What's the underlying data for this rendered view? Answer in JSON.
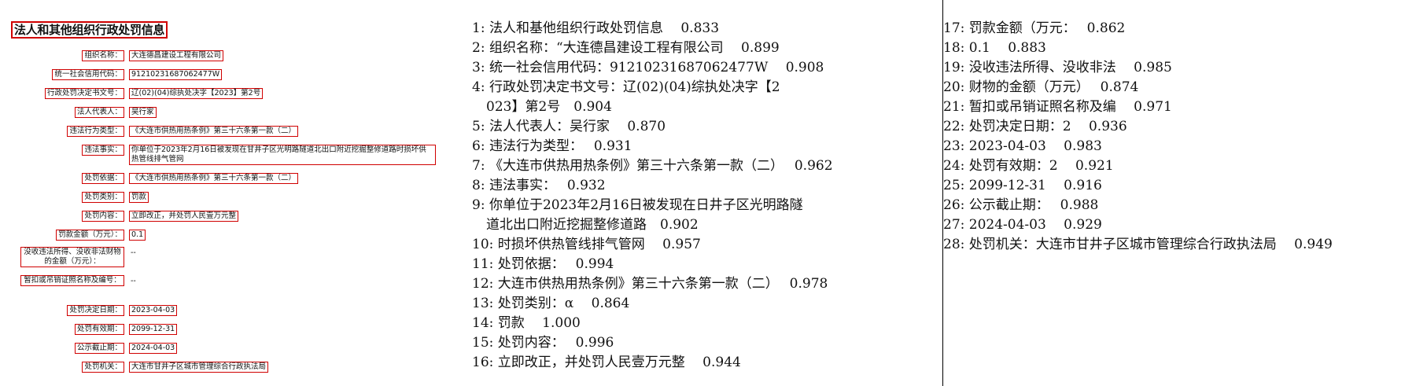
{
  "document": {
    "title": "法人和其他组织行政处罚信息",
    "fields": [
      {
        "label": "组织名称：",
        "value": "大连德昌建设工程有限公司"
      },
      {
        "label": "统一社会信用代码：",
        "value": "91210231687062477W"
      },
      {
        "label": "行政处罚决定书文号：",
        "value": "辽(02)(04)综执处决字【2023】第2号"
      },
      {
        "label": "法人代表人：",
        "value": "吴行家"
      },
      {
        "label": "违法行为类型：",
        "value": "《大连市供热用热条例》第三十六条第一款（二）"
      },
      {
        "label": "违法事实：",
        "value": "你单位于2023年2月16日被发现在甘井子区光明路隧道北出口附近挖掘整修道路时损坏供热管线排气管网"
      },
      {
        "label": "处罚依据：",
        "value": "《大连市供热用热条例》第三十六条第一款（二）"
      },
      {
        "label": "处罚类别：",
        "value": "罚款"
      },
      {
        "label": "处罚内容：",
        "value": "立即改正，并处罚人民壹万元整"
      },
      {
        "label": "罚款金额（万元）：",
        "value": "0.1"
      },
      {
        "label": "没收违法所得、没收非法财物的金额（万元）：",
        "value": "--"
      },
      {
        "label": "暂扣或吊销证照名称及编号：",
        "value": "--"
      },
      {
        "label": "处罚决定日期：",
        "value": "2023-04-03"
      },
      {
        "label": "处罚有效期：",
        "value": "2099-12-31"
      },
      {
        "label": "公示截止期：",
        "value": "2024-04-03"
      },
      {
        "label": "处罚机关：",
        "value": "大连市甘井子区城市管理综合行政执法局"
      }
    ]
  },
  "ocr_results": {
    "column1": [
      "1: 法人和基他组织行政处罚信息　 0.833",
      "2: 组织名称：“大连德昌建设工程有限公司　 0.899",
      "3: 统一社会信用代码：91210231687062477W　 0.908",
      "4: 行政处罚决定书文号：辽(02)(04)综执处决字【2",
      "023】第2号　0.904",
      "5: 法人代表人：吴行家　 0.870",
      "6: 违法行为类型：　 0.931",
      "7: 《大连市供热用热条例》第三十六条第一款（二）　 0.962",
      "8: 违法事实：　 0.932",
      "9: 你单位于2023年2月16日被发现在日井子区光明路隧",
      "道北出口附近挖掘整修道路　0.902",
      "10: 时损坏供热管线排气管网　 0.957",
      "11: 处罚依据：　 0.994",
      "12: 大连市供热用热条例》第三十六条第一款（二）　 0.978",
      "13: 处罚类别：α　 0.864",
      "14: 罚款　 1.000",
      "15: 处罚内容：　 0.996",
      "16: 立即改正，并处罚人民壹万元整　 0.944"
    ],
    "column2": [
      "17: 罚款金额（万元：　 0.862",
      "18: 0.1　 0.883",
      "19: 没收违法所得、没收非法　 0.985",
      "20: 财物的金额（万元）　 0.874",
      "21: 暂扣或吊销证照名称及编　 0.971",
      "22: 处罚决定日期：2　 0.936",
      "23: 2023-04-03　 0.983",
      "24: 处罚有效期：2　 0.921",
      "25: 2099-12-31　 0.916",
      "26: 公示截止期：　 0.988",
      "27: 2024-04-03　 0.929",
      "28: 处罚机关：大连市甘井子区城市管理综合行政执法局　 0.949"
    ]
  },
  "colors": {
    "annotation_box": "#d00000",
    "divider": "#000000"
  }
}
